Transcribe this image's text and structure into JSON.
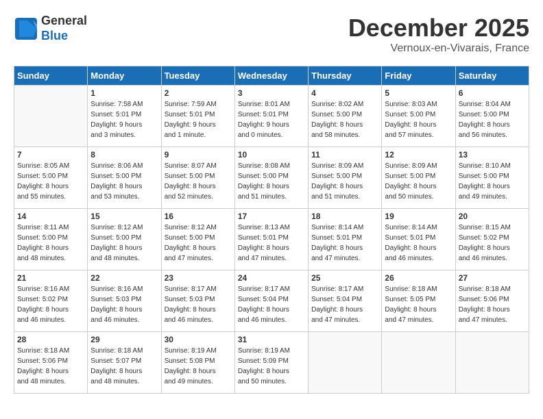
{
  "header": {
    "logo_line1": "General",
    "logo_line2": "Blue",
    "month": "December 2025",
    "location": "Vernoux-en-Vivarais, France"
  },
  "weekdays": [
    "Sunday",
    "Monday",
    "Tuesday",
    "Wednesday",
    "Thursday",
    "Friday",
    "Saturday"
  ],
  "weeks": [
    [
      {
        "day": "",
        "info": ""
      },
      {
        "day": "1",
        "info": "Sunrise: 7:58 AM\nSunset: 5:01 PM\nDaylight: 9 hours\nand 3 minutes."
      },
      {
        "day": "2",
        "info": "Sunrise: 7:59 AM\nSunset: 5:01 PM\nDaylight: 9 hours\nand 1 minute."
      },
      {
        "day": "3",
        "info": "Sunrise: 8:01 AM\nSunset: 5:01 PM\nDaylight: 9 hours\nand 0 minutes."
      },
      {
        "day": "4",
        "info": "Sunrise: 8:02 AM\nSunset: 5:00 PM\nDaylight: 8 hours\nand 58 minutes."
      },
      {
        "day": "5",
        "info": "Sunrise: 8:03 AM\nSunset: 5:00 PM\nDaylight: 8 hours\nand 57 minutes."
      },
      {
        "day": "6",
        "info": "Sunrise: 8:04 AM\nSunset: 5:00 PM\nDaylight: 8 hours\nand 56 minutes."
      }
    ],
    [
      {
        "day": "7",
        "info": "Sunrise: 8:05 AM\nSunset: 5:00 PM\nDaylight: 8 hours\nand 55 minutes."
      },
      {
        "day": "8",
        "info": "Sunrise: 8:06 AM\nSunset: 5:00 PM\nDaylight: 8 hours\nand 53 minutes."
      },
      {
        "day": "9",
        "info": "Sunrise: 8:07 AM\nSunset: 5:00 PM\nDaylight: 8 hours\nand 52 minutes."
      },
      {
        "day": "10",
        "info": "Sunrise: 8:08 AM\nSunset: 5:00 PM\nDaylight: 8 hours\nand 51 minutes."
      },
      {
        "day": "11",
        "info": "Sunrise: 8:09 AM\nSunset: 5:00 PM\nDaylight: 8 hours\nand 51 minutes."
      },
      {
        "day": "12",
        "info": "Sunrise: 8:09 AM\nSunset: 5:00 PM\nDaylight: 8 hours\nand 50 minutes."
      },
      {
        "day": "13",
        "info": "Sunrise: 8:10 AM\nSunset: 5:00 PM\nDaylight: 8 hours\nand 49 minutes."
      }
    ],
    [
      {
        "day": "14",
        "info": "Sunrise: 8:11 AM\nSunset: 5:00 PM\nDaylight: 8 hours\nand 48 minutes."
      },
      {
        "day": "15",
        "info": "Sunrise: 8:12 AM\nSunset: 5:00 PM\nDaylight: 8 hours\nand 48 minutes."
      },
      {
        "day": "16",
        "info": "Sunrise: 8:12 AM\nSunset: 5:00 PM\nDaylight: 8 hours\nand 47 minutes."
      },
      {
        "day": "17",
        "info": "Sunrise: 8:13 AM\nSunset: 5:01 PM\nDaylight: 8 hours\nand 47 minutes."
      },
      {
        "day": "18",
        "info": "Sunrise: 8:14 AM\nSunset: 5:01 PM\nDaylight: 8 hours\nand 47 minutes."
      },
      {
        "day": "19",
        "info": "Sunrise: 8:14 AM\nSunset: 5:01 PM\nDaylight: 8 hours\nand 46 minutes."
      },
      {
        "day": "20",
        "info": "Sunrise: 8:15 AM\nSunset: 5:02 PM\nDaylight: 8 hours\nand 46 minutes."
      }
    ],
    [
      {
        "day": "21",
        "info": "Sunrise: 8:16 AM\nSunset: 5:02 PM\nDaylight: 8 hours\nand 46 minutes."
      },
      {
        "day": "22",
        "info": "Sunrise: 8:16 AM\nSunset: 5:03 PM\nDaylight: 8 hours\nand 46 minutes."
      },
      {
        "day": "23",
        "info": "Sunrise: 8:17 AM\nSunset: 5:03 PM\nDaylight: 8 hours\nand 46 minutes."
      },
      {
        "day": "24",
        "info": "Sunrise: 8:17 AM\nSunset: 5:04 PM\nDaylight: 8 hours\nand 46 minutes."
      },
      {
        "day": "25",
        "info": "Sunrise: 8:17 AM\nSunset: 5:04 PM\nDaylight: 8 hours\nand 47 minutes."
      },
      {
        "day": "26",
        "info": "Sunrise: 8:18 AM\nSunset: 5:05 PM\nDaylight: 8 hours\nand 47 minutes."
      },
      {
        "day": "27",
        "info": "Sunrise: 8:18 AM\nSunset: 5:06 PM\nDaylight: 8 hours\nand 47 minutes."
      }
    ],
    [
      {
        "day": "28",
        "info": "Sunrise: 8:18 AM\nSunset: 5:06 PM\nDaylight: 8 hours\nand 48 minutes."
      },
      {
        "day": "29",
        "info": "Sunrise: 8:18 AM\nSunset: 5:07 PM\nDaylight: 8 hours\nand 48 minutes."
      },
      {
        "day": "30",
        "info": "Sunrise: 8:19 AM\nSunset: 5:08 PM\nDaylight: 8 hours\nand 49 minutes."
      },
      {
        "day": "31",
        "info": "Sunrise: 8:19 AM\nSunset: 5:09 PM\nDaylight: 8 hours\nand 50 minutes."
      },
      {
        "day": "",
        "info": ""
      },
      {
        "day": "",
        "info": ""
      },
      {
        "day": "",
        "info": ""
      }
    ]
  ]
}
